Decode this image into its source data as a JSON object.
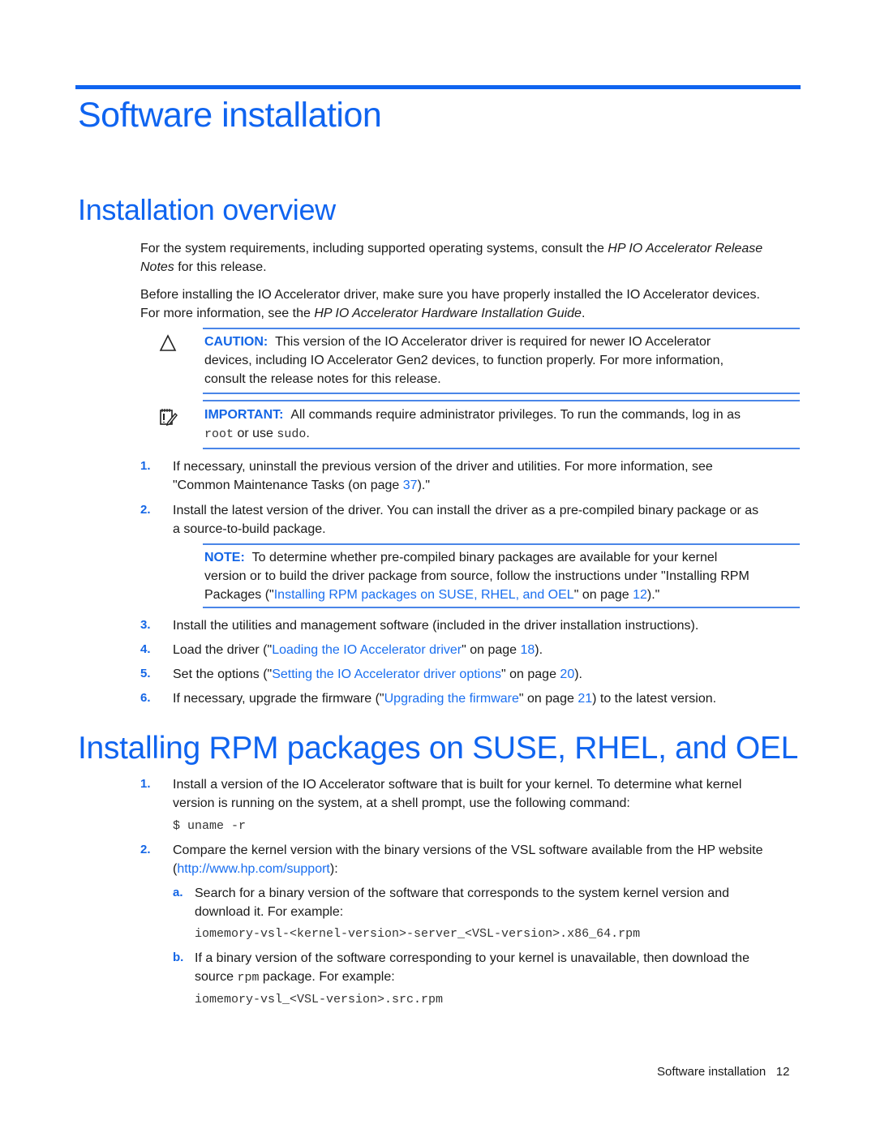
{
  "page": {
    "title": "Software installation",
    "footer": {
      "section": "Software installation",
      "page_number": "12"
    }
  },
  "overview": {
    "heading": "Installation overview",
    "para1": {
      "pre": "For the system requirements, including supported operating systems, consult the ",
      "italic": "HP IO Accelerator Release",
      "line2_italic": "Notes",
      "line2_post": " for this release."
    },
    "para2": {
      "line1": "Before installing the IO Accelerator driver, make sure you have properly installed the IO Accelerator devices.",
      "line2_pre": "For more information, see the ",
      "line2_italic": "HP IO Accelerator Hardware Installation Guide",
      "line2_post": "."
    },
    "caution": {
      "icon": "caution-triangle-icon",
      "label": "CAUTION:",
      "line1": "This version of the IO Accelerator driver is required for newer IO Accelerator",
      "line2": "devices, including IO Accelerator Gen2 devices, to function properly. For more information,",
      "line3": "consult the release notes for this release."
    },
    "important": {
      "icon": "important-notepad-icon",
      "label": "IMPORTANT:",
      "line1": "All commands require administrator privileges. To run the commands, log in as",
      "code1": "root",
      "mid": " or use ",
      "code2": "sudo",
      "end": "."
    },
    "steps": [
      {
        "num": "1.",
        "line1": "If necessary, uninstall the previous version of the driver and utilities. For more information, see",
        "line2_pre": "\"Common Maintenance Tasks (on page ",
        "line2_link": "37",
        "line2_post": ").\""
      },
      {
        "num": "2.",
        "line1": "Install the latest version of the driver. You can install the driver as a pre-compiled binary package or as",
        "line2": "a source-to-build package."
      },
      {
        "num": "3.",
        "text": "Install the utilities and management software (included in the driver installation instructions)."
      },
      {
        "num": "4.",
        "pre": "Load the driver (\"",
        "link": "Loading the IO Accelerator driver",
        "mid": "\" on page ",
        "page": "18",
        "post": ")."
      },
      {
        "num": "5.",
        "pre": "Set the options (\"",
        "link": "Setting the IO Accelerator driver options",
        "mid": "\" on page ",
        "page": "20",
        "post": ")."
      },
      {
        "num": "6.",
        "pre": "If necessary, upgrade the firmware (\"",
        "link": "Upgrading the firmware",
        "mid": "\" on page ",
        "page": "21",
        "post": ") to the latest version."
      }
    ],
    "note": {
      "label": "NOTE:",
      "line1": "To determine whether pre-compiled binary packages are available for your kernel",
      "line2": "version or to build the driver package from source, follow the instructions under \"Installing RPM",
      "line3_pre": "Packages (\"",
      "line3_link": "Installing RPM packages on SUSE, RHEL, and OEL",
      "line3_mid": "\" on page ",
      "line3_page": "12",
      "line3_post": ").\""
    }
  },
  "rpm": {
    "heading": "Installing RPM packages on SUSE, RHEL, and OEL",
    "step1": {
      "num": "1.",
      "line1": "Install a version of the IO Accelerator software that is built for your kernel. To determine what kernel",
      "line2": "version is running on the system, at a shell prompt, use the following command:",
      "command": "$ uname -r"
    },
    "step2": {
      "num": "2.",
      "line1": "Compare the kernel version with the binary versions of the VSL software available from the HP website",
      "line2_pre": "(",
      "line2_link": "http://www.hp.com/support",
      "line2_post": "):",
      "sub": [
        {
          "letter": "a.",
          "line1": "Search for a binary version of the software that corresponds to the system kernel version and",
          "line2": "download it. For example:",
          "code": "iomemory-vsl-<kernel-version>-server_<VSL-version>.x86_64.rpm"
        },
        {
          "letter": "b.",
          "line1": "If a binary version of the software corresponding to your kernel is unavailable, then download the",
          "line2_pre": "source ",
          "line2_code": "rpm",
          "line2_post": " package. For example:",
          "code": "iomemory-vsl_<VSL-version>.src.rpm"
        }
      ]
    }
  }
}
